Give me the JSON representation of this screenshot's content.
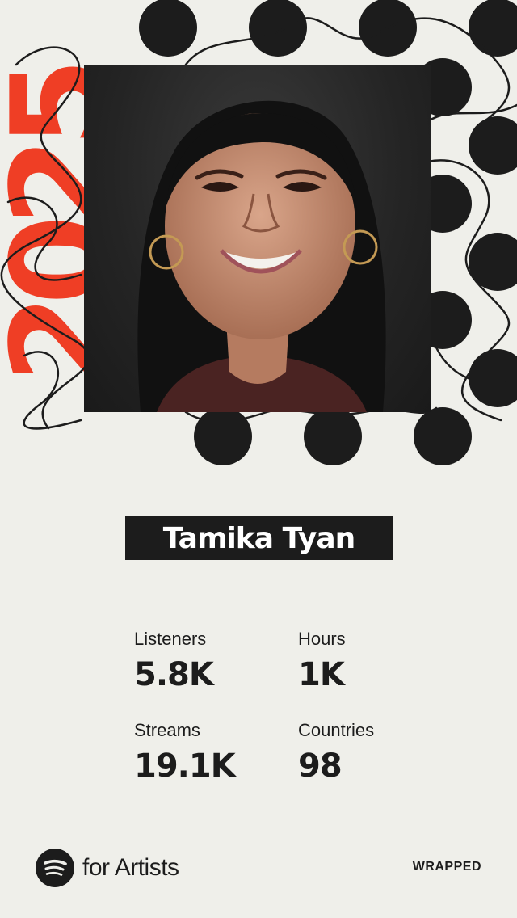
{
  "year": "2025",
  "artist": {
    "name": "Tamika Tyan"
  },
  "stats": [
    {
      "label": "Listeners",
      "value": "5.8K"
    },
    {
      "label": "Hours",
      "value": "1K"
    },
    {
      "label": "Streams",
      "value": "19.1K"
    },
    {
      "label": "Countries",
      "value": "98"
    }
  ],
  "footer": {
    "brand": "for Artists",
    "tag": "WRAPPED"
  },
  "colors": {
    "background": "#efefea",
    "accent": "#ef3e25",
    "ink": "#1c1c1c"
  },
  "icons": {
    "brand": "spotify-logo-icon"
  }
}
